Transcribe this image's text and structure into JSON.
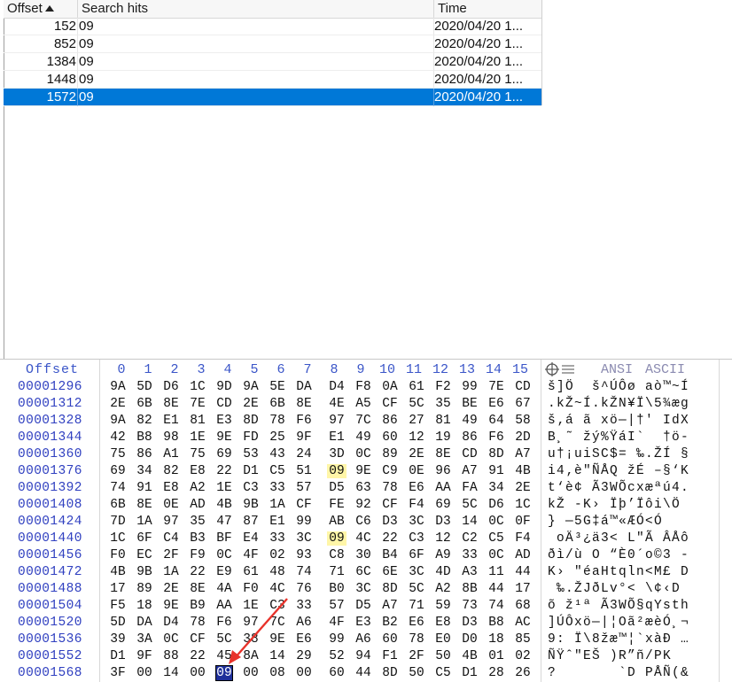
{
  "hits_table": {
    "columns": {
      "offset": "Offset",
      "search_hits": "Search hits",
      "time": "Time"
    },
    "rows": [
      {
        "offset": "152",
        "hits": "09",
        "time": "2020/04/20  1...",
        "selected": false
      },
      {
        "offset": "852",
        "hits": "09",
        "time": "2020/04/20  1...",
        "selected": false
      },
      {
        "offset": "1384",
        "hits": "09",
        "time": "2020/04/20  1...",
        "selected": false
      },
      {
        "offset": "1448",
        "hits": "09",
        "time": "2020/04/20  1...",
        "selected": false
      },
      {
        "offset": "1572",
        "hits": "09",
        "time": "2020/04/20  1...",
        "selected": true
      }
    ],
    "selection_color": "#0078d7"
  },
  "hex_view": {
    "offset_header": "Offset",
    "column_headers": [
      "0",
      "1",
      "2",
      "3",
      "4",
      "5",
      "6",
      "7",
      "8",
      "9",
      "10",
      "11",
      "12",
      "13",
      "14",
      "15"
    ],
    "ansi_label": "ANSI",
    "ascii_label": "ASCII",
    "icon": "crosshair-list-icon",
    "highlight_color": "#fff6a8",
    "rows": [
      {
        "offset": "00001296",
        "bytes": [
          "9A",
          "5D",
          "D6",
          "1C",
          "9D",
          "9A",
          "5E",
          "DA",
          "D4",
          "F8",
          "0A",
          "61",
          "F2",
          "99",
          "7E",
          "CD"
        ],
        "ascii": "š]Ö  š^ÚÔø aò™~Í"
      },
      {
        "offset": "00001312",
        "bytes": [
          "2E",
          "6B",
          "8E",
          "7E",
          "CD",
          "2E",
          "6B",
          "8E",
          "4E",
          "A5",
          "CF",
          "5C",
          "35",
          "BE",
          "E6",
          "67"
        ],
        "ascii": ".kŽ~Í.kŽN¥Ï\\5¾æg"
      },
      {
        "offset": "00001328",
        "bytes": [
          "9A",
          "82",
          "E1",
          "81",
          "E3",
          "8D",
          "78",
          "F6",
          "97",
          "7C",
          "86",
          "27",
          "81",
          "49",
          "64",
          "58"
        ],
        "ascii": "š‚á ã xö—|†' IdX"
      },
      {
        "offset": "00001344",
        "bytes": [
          "42",
          "B8",
          "98",
          "1E",
          "9E",
          "FD",
          "25",
          "9F",
          "E1",
          "49",
          "60",
          "12",
          "19",
          "86",
          "F6",
          "2D"
        ],
        "ascii": "B¸˜ žý%ŸáI`  †ö-"
      },
      {
        "offset": "00001360",
        "bytes": [
          "75",
          "86",
          "A1",
          "75",
          "69",
          "53",
          "43",
          "24",
          "3D",
          "0C",
          "89",
          "2E",
          "8E",
          "CD",
          "8D",
          "A7"
        ],
        "ascii": "u†¡uiSC$= ‰.ŽÍ §"
      },
      {
        "offset": "00001376",
        "bytes": [
          "69",
          "34",
          "82",
          "E8",
          "22",
          "D1",
          "C5",
          "51",
          "09",
          "9E",
          "C9",
          "0E",
          "96",
          "A7",
          "91",
          "4B"
        ],
        "ascii": "i4‚è\"ÑÅQ žÉ –§‘K",
        "hl_byte": 8,
        "hl_asc": 8
      },
      {
        "offset": "00001392",
        "bytes": [
          "74",
          "91",
          "E8",
          "A2",
          "1E",
          "C3",
          "33",
          "57",
          "D5",
          "63",
          "78",
          "E6",
          "AA",
          "FA",
          "34",
          "2E"
        ],
        "ascii": "t‘è¢ Ã3WÕcxæªú4."
      },
      {
        "offset": "00001408",
        "bytes": [
          "6B",
          "8E",
          "0E",
          "AD",
          "4B",
          "9B",
          "1A",
          "CF",
          "FE",
          "92",
          "CF",
          "F4",
          "69",
          "5C",
          "D6",
          "1C"
        ],
        "ascii": "kŽ -K› Ïþ’Ïôi\\Ö "
      },
      {
        "offset": "00001424",
        "bytes": [
          "7D",
          "1A",
          "97",
          "35",
          "47",
          "87",
          "E1",
          "99",
          "AB",
          "C6",
          "D3",
          "3C",
          "D3",
          "14",
          "0C",
          "0F"
        ],
        "ascii": "} —5G‡á™«ÆÓ<Ó   "
      },
      {
        "offset": "00001440",
        "bytes": [
          "1C",
          "6F",
          "C4",
          "B3",
          "BF",
          "E4",
          "33",
          "3C",
          "09",
          "4C",
          "22",
          "C3",
          "12",
          "C2",
          "C5",
          "F4"
        ],
        "ascii": " oÄ³¿ä3< L\"Ã ÂÅô",
        "hl_byte": 8,
        "hl_asc": 8
      },
      {
        "offset": "00001456",
        "bytes": [
          "F0",
          "EC",
          "2F",
          "F9",
          "0C",
          "4F",
          "02",
          "93",
          "C8",
          "30",
          "B4",
          "6F",
          "A9",
          "33",
          "0C",
          "AD"
        ],
        "ascii": "ðì/ù O “È0´o©3 -"
      },
      {
        "offset": "00001472",
        "bytes": [
          "4B",
          "9B",
          "1A",
          "22",
          "E9",
          "61",
          "48",
          "74",
          "71",
          "6C",
          "6E",
          "3C",
          "4D",
          "A3",
          "11",
          "44"
        ],
        "ascii": "K› \"éaHtqln<M£ D"
      },
      {
        "offset": "00001488",
        "bytes": [
          "17",
          "89",
          "2E",
          "8E",
          "4A",
          "F0",
          "4C",
          "76",
          "B0",
          "3C",
          "8D",
          "5C",
          "A2",
          "8B",
          "44",
          "17"
        ],
        "ascii": " ‰.ŽJðLv°< \\¢‹D "
      },
      {
        "offset": "00001504",
        "bytes": [
          "F5",
          "18",
          "9E",
          "B9",
          "AA",
          "1E",
          "C3",
          "33",
          "57",
          "D5",
          "A7",
          "71",
          "59",
          "73",
          "74",
          "68"
        ],
        "ascii": "õ ž¹ª Ã3WÕ§qYsth"
      },
      {
        "offset": "00001520",
        "bytes": [
          "5D",
          "DA",
          "D4",
          "78",
          "F6",
          "97",
          "7C",
          "A6",
          "4F",
          "E3",
          "B2",
          "E6",
          "E8",
          "D3",
          "B8",
          "AC"
        ],
        "ascii": "]ÚÔxö—|¦Oã²æèÓ¸¬"
      },
      {
        "offset": "00001536",
        "bytes": [
          "39",
          "3A",
          "0C",
          "CF",
          "5C",
          "38",
          "9E",
          "E6",
          "99",
          "A6",
          "60",
          "78",
          "E0",
          "D0",
          "18",
          "85"
        ],
        "ascii": "9: Ï\\8žæ™¦`xàÐ …"
      },
      {
        "offset": "00001552",
        "bytes": [
          "D1",
          "9F",
          "88",
          "22",
          "45",
          "8A",
          "14",
          "29",
          "52",
          "94",
          "F1",
          "2F",
          "50",
          "4B",
          "01",
          "02"
        ],
        "ascii": "ÑŸˆ\"EŠ )R”ñ/PK  "
      },
      {
        "offset": "00001568",
        "bytes": [
          "3F",
          "00",
          "14",
          "00",
          "09",
          "00",
          "08",
          "00",
          "60",
          "44",
          "8D",
          "50",
          "C5",
          "D1",
          "28",
          "26"
        ],
        "ascii": "?       `D PÅÑ(&",
        "cur_byte": 4,
        "cur_asc": 4
      }
    ]
  }
}
